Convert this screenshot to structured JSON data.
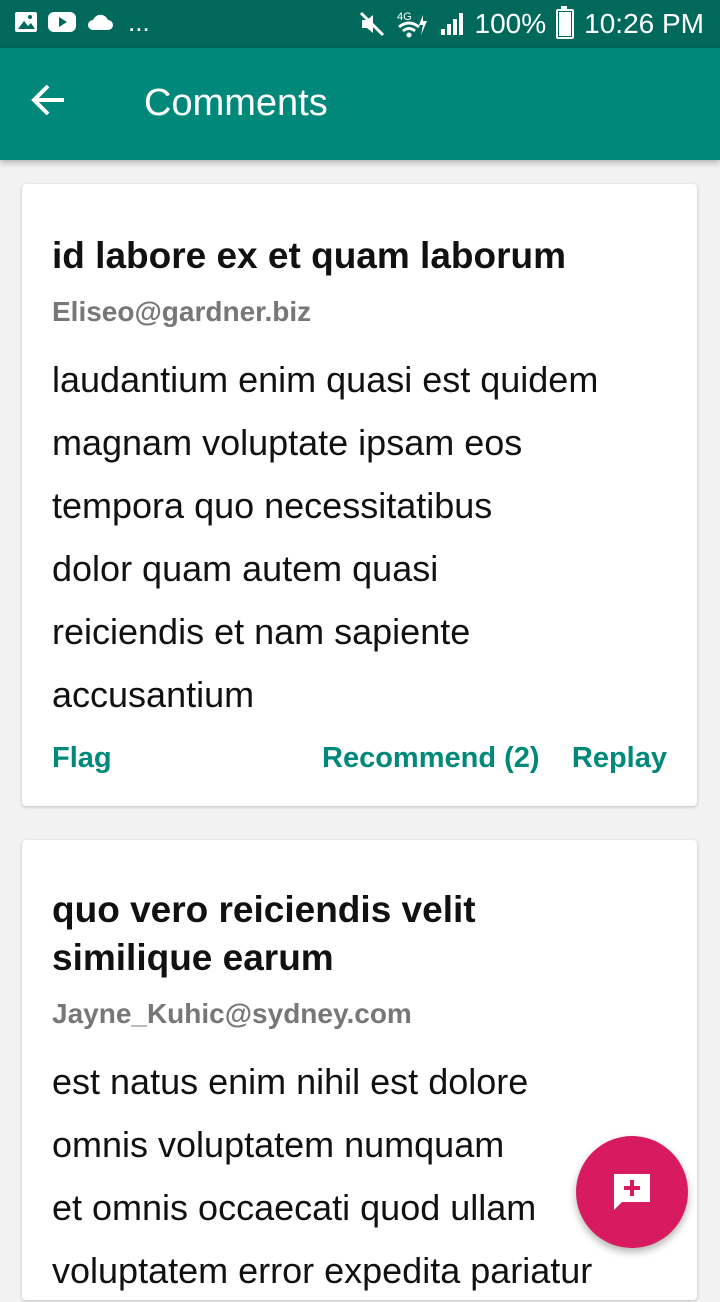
{
  "status_bar": {
    "left_icons": [
      "image-icon",
      "youtube-icon",
      "cloud-icon"
    ],
    "more": "...",
    "battery_percent": "100%",
    "time": "10:26 PM",
    "network": "4G"
  },
  "app_bar": {
    "title": "Comments",
    "back_icon": "arrow-back-icon"
  },
  "comments": [
    {
      "title": "id labore ex et quam laborum",
      "email": "Eliseo@gardner.biz",
      "body_lines": [
        "laudantium enim quasi est quidem",
        "magnam voluptate ipsam eos",
        "tempora quo necessitatibus",
        "dolor quam autem quasi",
        "reiciendis et nam sapiente",
        "accusantium"
      ],
      "actions": {
        "flag": "Flag",
        "recommend": "Recommend (2)",
        "reply": "Replay"
      }
    },
    {
      "title_lines": [
        "quo vero reiciendis velit",
        "similique earum"
      ],
      "email": "Jayne_Kuhic@sydney.com",
      "body_lines": [
        "est natus enim nihil est dolore",
        "omnis voluptatem numquam",
        "et omnis occaecati quod ullam",
        "voluptatem error expedita pariatur"
      ]
    }
  ],
  "fab": {
    "icon": "add-comment-icon",
    "color": "#d81b60"
  },
  "colors": {
    "primary": "#00897b",
    "primary_dark": "#00695c",
    "accent": "#d81b60"
  }
}
